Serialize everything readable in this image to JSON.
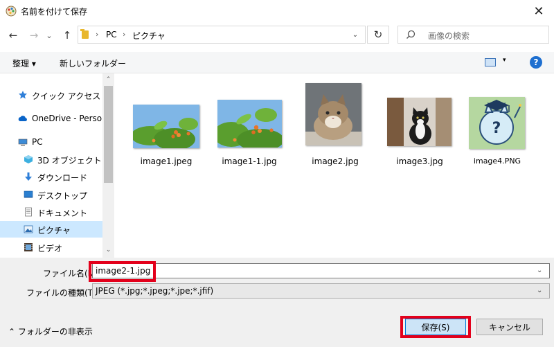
{
  "window": {
    "title": "名前を付けて保存",
    "close": "✕"
  },
  "nav_buttons": {
    "back": "←",
    "forward": "→",
    "dropdown": "⌄",
    "up": "↑"
  },
  "address": {
    "crumbs": [
      "PC",
      "ピクチャ"
    ],
    "separator": "›",
    "dropdown": "⌄",
    "refresh": "↻"
  },
  "search": {
    "placeholder": "画像の検索"
  },
  "toolbar": {
    "organize": "整理 ▾",
    "new_folder": "新しいフォルダー",
    "view_dropdown": "▾",
    "help": "?"
  },
  "sidebar": {
    "items": [
      {
        "label": "クイック アクセス",
        "icon": "star-icon"
      },
      {
        "label": "OneDrive - Person",
        "icon": "cloud-icon"
      },
      {
        "label": "PC",
        "icon": "pc-icon"
      },
      {
        "label": "3D オブジェクト",
        "icon": "cube-icon"
      },
      {
        "label": "ダウンロード",
        "icon": "download-icon"
      },
      {
        "label": "デスクトップ",
        "icon": "desktop-icon"
      },
      {
        "label": "ドキュメント",
        "icon": "document-icon"
      },
      {
        "label": "ピクチャ",
        "icon": "pictures-icon",
        "selected": true
      },
      {
        "label": "ビデオ",
        "icon": "video-icon"
      }
    ],
    "scroll_up": "⌃",
    "scroll_down": "⌄"
  },
  "files": [
    {
      "name": "image1.jpeg"
    },
    {
      "name": "image1-1.jpg"
    },
    {
      "name": "image2.jpg"
    },
    {
      "name": "image3.jpg"
    },
    {
      "name": "image4.PNG"
    }
  ],
  "form": {
    "filename_label": "ファイル名(N):",
    "filename_value": "image2-1.jpg",
    "filetype_label": "ファイルの種類(T):",
    "filetype_value": "JPEG (*.jpg;*.jpeg;*.jpe;*.jfif)",
    "dropdown": "⌄"
  },
  "footer": {
    "hide_folders": "⌃ フォルダーの非表示",
    "save": "保存(S)",
    "cancel": "キャンセル"
  },
  "colors": {
    "highlight": "#e3001b",
    "selected_nav": "#cce8ff",
    "accent": "#0078d7"
  }
}
